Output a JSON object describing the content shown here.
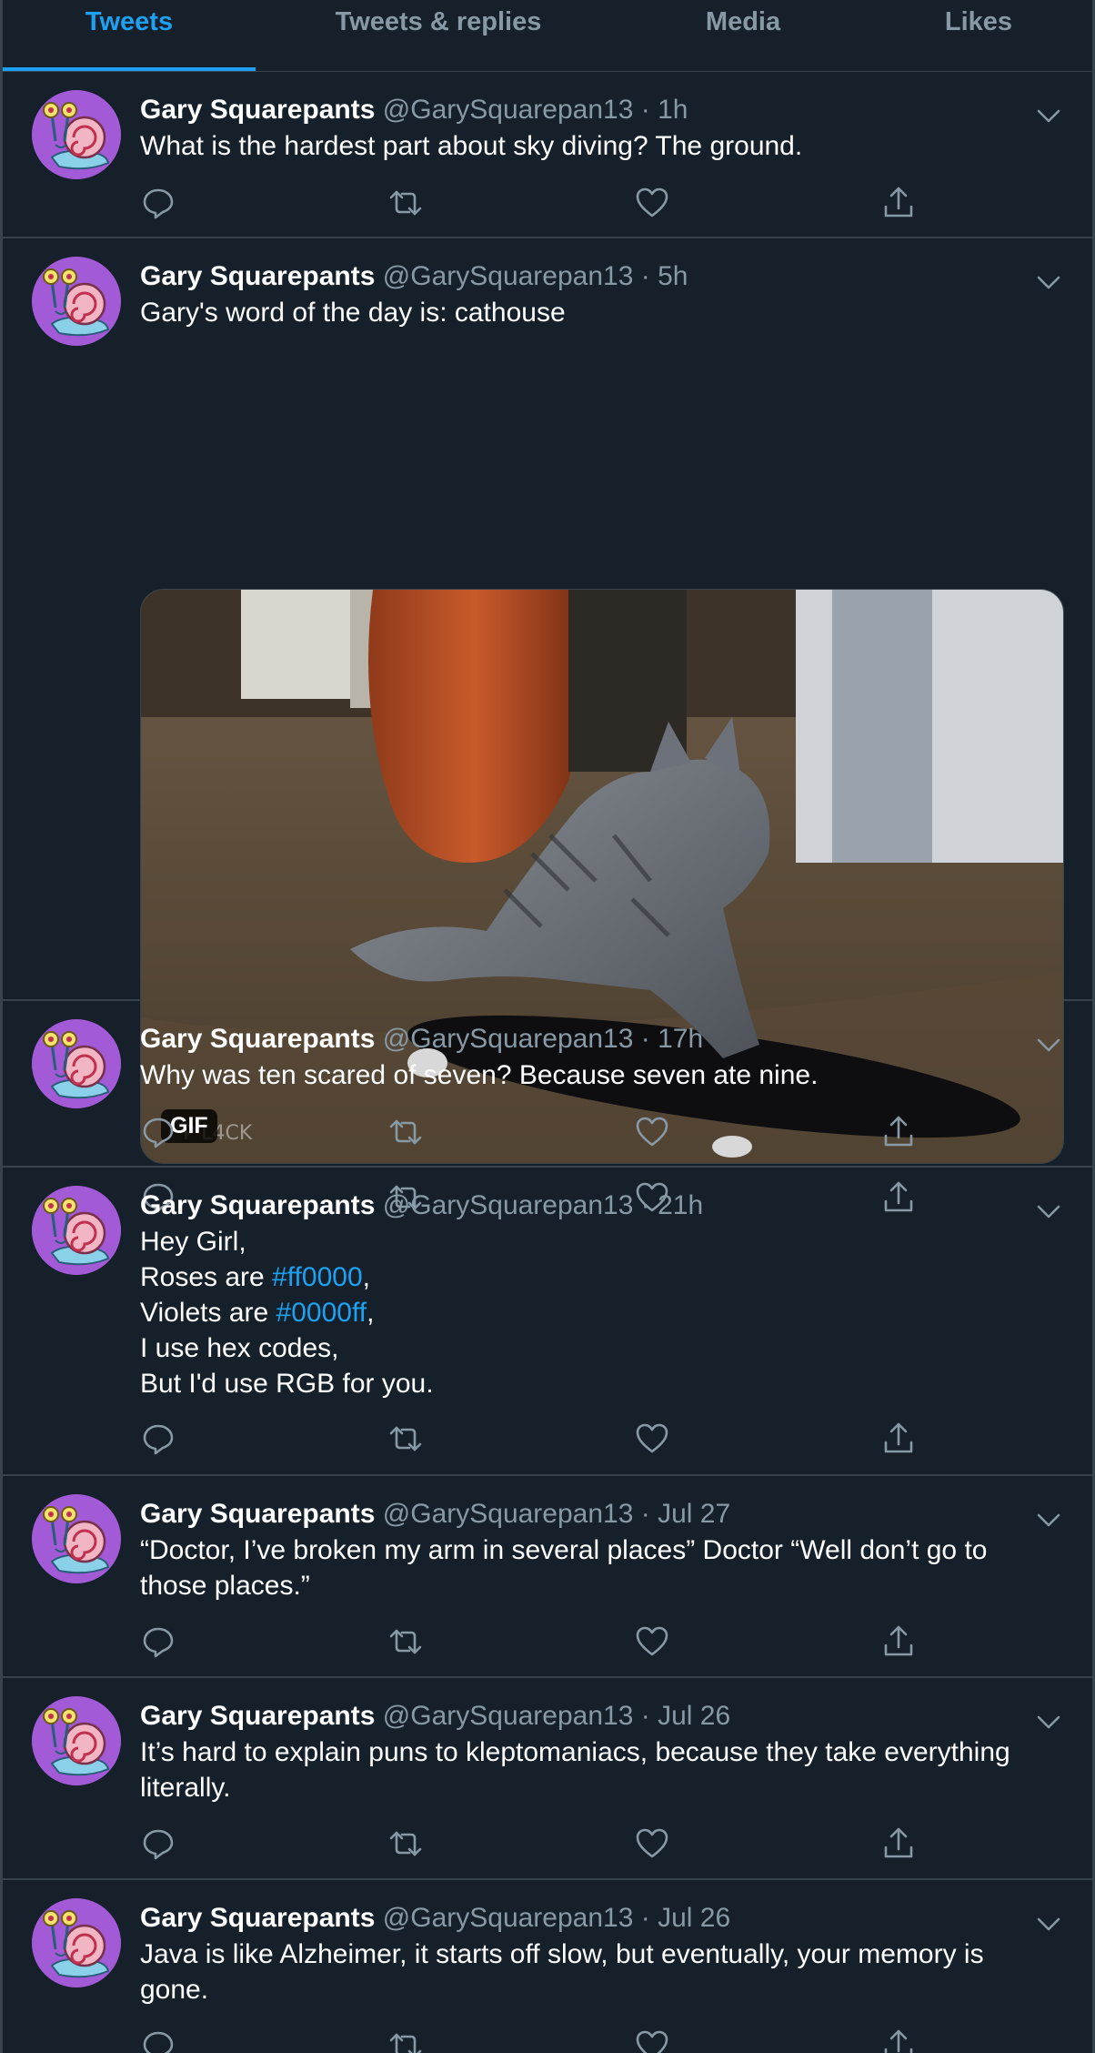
{
  "tabs": [
    "Tweets",
    "Tweets & replies",
    "Media",
    "Likes"
  ],
  "author": {
    "name": "Gary Squarepants",
    "handle": "@GarySquarepan13"
  },
  "media": {
    "badge": "GIF"
  },
  "colors": {
    "background": "#15202b",
    "accent": "#1da1f2",
    "muted": "#8899a6",
    "border": "#38444d"
  },
  "tweets": [
    {
      "time": "1h",
      "lines": [
        "What is the hardest part about sky diving? The ground."
      ]
    },
    {
      "time": "5h",
      "lines": [
        "Gary's word of the day is: cathouse"
      ],
      "has_gif": true
    },
    {
      "time": "17h",
      "lines": [
        "Why was ten scared of seven? Because seven ate nine."
      ]
    },
    {
      "time": "21h",
      "lines": [
        "Hey Girl,"
      ],
      "line2": {
        "pre": "Roses are ",
        "tag": "#ff0000",
        "post": ","
      },
      "line3": {
        "pre": "Violets are ",
        "tag": "#0000ff",
        "post": ","
      },
      "lines_after": [
        "I use hex codes,",
        "But I'd use RGB for you."
      ]
    },
    {
      "time": "Jul 27",
      "lines": [
        "“Doctor, I’ve broken my arm in several places” Doctor “Well don’t go to",
        "those places.”"
      ]
    },
    {
      "time": "Jul 26",
      "lines": [
        "It’s hard to explain puns to kleptomaniacs, because they take everything",
        "literally."
      ]
    },
    {
      "time": "Jul 26",
      "lines": [
        "Java is like Alzheimer, it starts off slow, but eventually, your memory is",
        "gone."
      ]
    }
  ]
}
